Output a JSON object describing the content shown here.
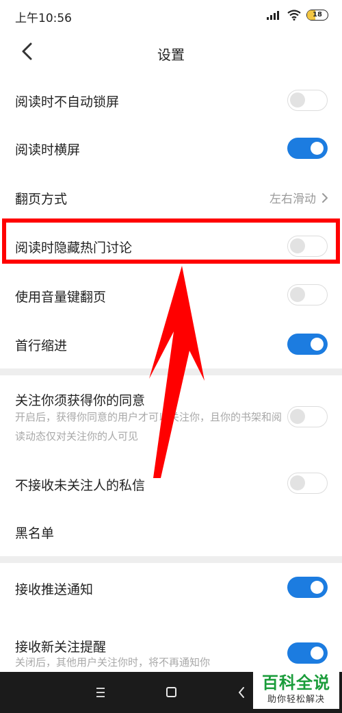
{
  "status_bar": {
    "time": "上午10:56",
    "battery": "18",
    "icons": [
      "signal-icon",
      "wifi-icon",
      "battery-icon"
    ]
  },
  "header": {
    "title": "设置",
    "back_icon": "chevron-left-icon"
  },
  "settings": {
    "no_auto_lock": {
      "label": "阅读时不自动锁屏",
      "enabled": false
    },
    "landscape": {
      "label": "阅读时横屏",
      "enabled": true
    },
    "page_turn": {
      "label": "翻页方式",
      "value": "左右滑动"
    },
    "hide_hot_discussion": {
      "label": "阅读时隐藏热门讨论",
      "enabled": false
    },
    "volume_key_turn": {
      "label": "使用音量键翻页",
      "enabled": false
    },
    "first_line_indent": {
      "label": "首行缩进",
      "enabled": true
    },
    "follow_consent": {
      "label": "关注你须获得你的同意",
      "description": "开启后，获得你同意的用户才可以关注你，且你的书架和阅读动态仅对关注你的人可见",
      "enabled": false
    },
    "no_stranger_dm": {
      "label": "不接收未关注人的私信",
      "enabled": false
    },
    "blacklist": {
      "label": "黑名单"
    },
    "push_notifications": {
      "label": "接收推送通知",
      "enabled": true
    },
    "new_follower_alert": {
      "label": "接收新关注提醒",
      "description": "关闭后，其他用户关注你时，将不再通知你",
      "enabled": true
    }
  },
  "colors": {
    "toggle_on": "#1c7ce0",
    "annotation": "#ff0000",
    "watermark_green": "#1a9c3a"
  },
  "nav_bar": {
    "icons": [
      "menu-icon",
      "home-icon",
      "back-icon"
    ]
  },
  "watermark": {
    "title": "百科全说",
    "subtitle": "助你轻松解决"
  }
}
